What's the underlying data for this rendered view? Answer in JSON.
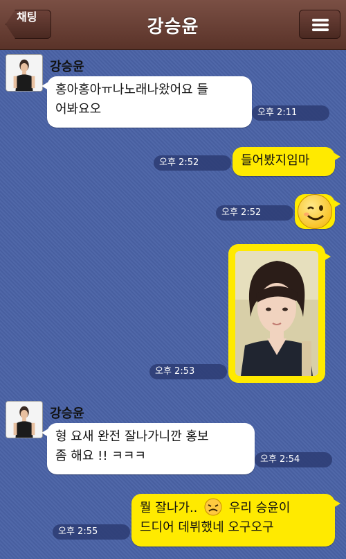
{
  "navbar": {
    "back_label": "채팅",
    "title": "강승윤"
  },
  "messages": [
    {
      "sender": "강승윤",
      "line1": "홍아홍아ㅠ나노래나왔어요 들",
      "line2": "어봐요오",
      "time": "오후 2:11"
    },
    {
      "text": "들어봤지임마",
      "time": "오후 2:52"
    },
    {
      "emoji": "wink-smiley-icon",
      "time": "오후 2:52"
    },
    {
      "image": "selfie-photo",
      "time": "오후 2:53"
    },
    {
      "sender": "강승윤",
      "line1": "형 요새 완전 잘나가니깐 홍보",
      "line2": "좀 해요 !! ㅋㅋㅋ",
      "time": "오후 2:54"
    },
    {
      "line1_a": "뭘 잘나가..",
      "line1_b": "우리 승윤이",
      "line2": "드디어 데뷔했네 오구오구",
      "time": "오후 2:55"
    }
  ],
  "colors": {
    "background": "#4a62a6",
    "navbar": "#5a3329",
    "my_bubble": "#ffea00",
    "their_bubble": "#ffffff"
  }
}
